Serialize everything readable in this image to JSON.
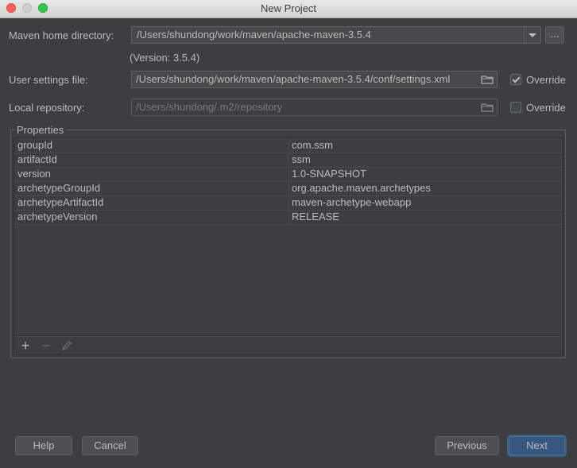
{
  "window": {
    "title": "New Project"
  },
  "maven_home": {
    "label": "Maven home directory:",
    "value": "/Users/shundong/work/maven/apache-maven-3.5.4",
    "browse_label": "...",
    "version_text": "(Version: 3.5.4)"
  },
  "user_settings": {
    "label": "User settings file:",
    "value": "/Users/shundong/work/maven/apache-maven-3.5.4/conf/settings.xml",
    "override_label": "Override",
    "override_checked": true
  },
  "local_repo": {
    "label": "Local repository:",
    "value": "/Users/shundong/.m2/repository",
    "override_label": "Override",
    "override_checked": false
  },
  "properties": {
    "title": "Properties",
    "rows": [
      {
        "key": "groupId",
        "value": "com.ssm"
      },
      {
        "key": "artifactId",
        "value": "ssm"
      },
      {
        "key": "version",
        "value": "1.0-SNAPSHOT"
      },
      {
        "key": "archetypeGroupId",
        "value": "org.apache.maven.archetypes"
      },
      {
        "key": "archetypeArtifactId",
        "value": "maven-archetype-webapp"
      },
      {
        "key": "archetypeVersion",
        "value": "RELEASE"
      }
    ],
    "tools": {
      "add": "+",
      "remove": "−"
    }
  },
  "buttons": {
    "help": "Help",
    "cancel": "Cancel",
    "previous": "Previous",
    "next": "Next"
  },
  "icons": [
    "close-icon",
    "minimize-icon",
    "maximize-icon",
    "chevron-down-icon",
    "folder-icon",
    "add-icon",
    "remove-icon",
    "edit-icon"
  ]
}
